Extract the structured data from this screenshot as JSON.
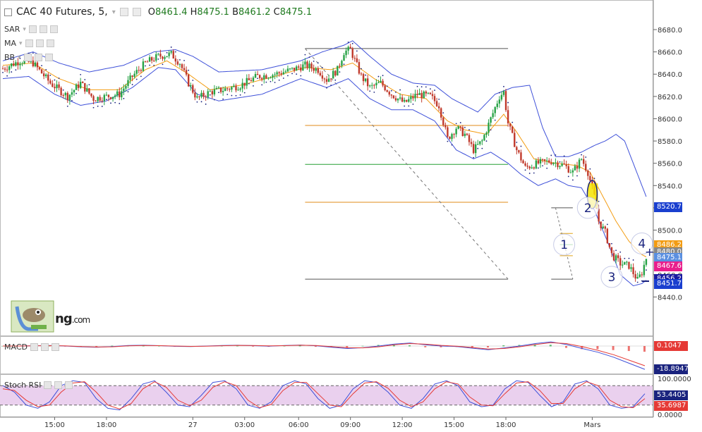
{
  "header": {
    "symbol": "CAC 40 Futures, 5,",
    "open_label": "O",
    "open": "8461.4",
    "high_label": "H",
    "high": "8475.1",
    "low_label": "B",
    "low": "8461.2",
    "close_label": "C",
    "close": "8475.1"
  },
  "indicators": {
    "sar": "SAR",
    "ma": "MA",
    "bb": "BB",
    "macd": "MACD",
    "stoch": "Stoch RSI"
  },
  "logo_text": "ng",
  "logo_suffix": ".com",
  "colors": {
    "up": "#26a245",
    "down": "#c0392b",
    "bb": "#3f51d9",
    "ma": "#f39c12",
    "sar": "#1a237e",
    "macd_line": "#3f51d9",
    "signal_line": "#e53935",
    "stoch_fill": "#ead0ee"
  },
  "chart_data": [
    {
      "type": "candlestick",
      "title": "CAC 40 Futures, 5",
      "ylim": [
        8436,
        8690
      ],
      "y_ticks": [
        "8680.0",
        "8660.0",
        "8640.0",
        "8620.0",
        "8600.0",
        "8580.0",
        "8560.0",
        "8540.0",
        "8520.7",
        "8500.0",
        "8480.0",
        "8460.0",
        "8440.0"
      ],
      "y_tick_values": [
        8680,
        8660,
        8640,
        8620,
        8600,
        8580,
        8560,
        8540,
        8520,
        8500,
        8480,
        8460,
        8440
      ],
      "x_ticks": [
        "15:00",
        "18:00",
        "27",
        "03:00",
        "06:00",
        "09:00",
        "12:00",
        "15:00",
        "18:00",
        "Mars"
      ],
      "x_tick_index": [
        24,
        48,
        88,
        112,
        137,
        161,
        185,
        209,
        233,
        273
      ],
      "close_path": [
        [
          0,
          8645
        ],
        [
          8,
          8652
        ],
        [
          14,
          8650
        ],
        [
          22,
          8632
        ],
        [
          30,
          8620
        ],
        [
          36,
          8632
        ],
        [
          42,
          8618
        ],
        [
          48,
          8620
        ],
        [
          54,
          8622
        ],
        [
          60,
          8638
        ],
        [
          66,
          8650
        ],
        [
          72,
          8656
        ],
        [
          78,
          8658
        ],
        [
          82,
          8650
        ],
        [
          86,
          8632
        ],
        [
          90,
          8618
        ],
        [
          96,
          8624
        ],
        [
          102,
          8626
        ],
        [
          110,
          8630
        ],
        [
          118,
          8638
        ],
        [
          126,
          8640
        ],
        [
          134,
          8644
        ],
        [
          140,
          8648
        ],
        [
          146,
          8644
        ],
        [
          150,
          8635
        ],
        [
          155,
          8644
        ],
        [
          158,
          8660
        ],
        [
          161,
          8662
        ],
        [
          166,
          8638
        ],
        [
          170,
          8628
        ],
        [
          175,
          8632
        ],
        [
          180,
          8622
        ],
        [
          186,
          8614
        ],
        [
          192,
          8622
        ],
        [
          198,
          8620
        ],
        [
          202,
          8612
        ],
        [
          206,
          8582
        ],
        [
          210,
          8592
        ],
        [
          214,
          8586
        ],
        [
          218,
          8572
        ],
        [
          222,
          8580
        ],
        [
          226,
          8600
        ],
        [
          230,
          8620
        ],
        [
          232,
          8624
        ],
        [
          234,
          8596
        ],
        [
          238,
          8572
        ],
        [
          242,
          8556
        ],
        [
          248,
          8560
        ],
        [
          254,
          8562
        ],
        [
          260,
          8558
        ],
        [
          264,
          8552
        ],
        [
          268,
          8564
        ],
        [
          271,
          8552
        ],
        [
          274,
          8530
        ],
        [
          276,
          8508
        ],
        [
          279,
          8498
        ],
        [
          282,
          8478
        ],
        [
          286,
          8470
        ],
        [
          290,
          8468
        ],
        [
          294,
          8455
        ],
        [
          296,
          8462
        ],
        [
          298,
          8475
        ]
      ],
      "bb_upper": [
        [
          0,
          8652
        ],
        [
          14,
          8660
        ],
        [
          26,
          8650
        ],
        [
          40,
          8642
        ],
        [
          56,
          8648
        ],
        [
          70,
          8660
        ],
        [
          80,
          8662
        ],
        [
          88,
          8656
        ],
        [
          100,
          8642
        ],
        [
          120,
          8644
        ],
        [
          138,
          8652
        ],
        [
          148,
          8660
        ],
        [
          158,
          8666
        ],
        [
          162,
          8670
        ],
        [
          170,
          8656
        ],
        [
          180,
          8640
        ],
        [
          190,
          8632
        ],
        [
          200,
          8630
        ],
        [
          208,
          8618
        ],
        [
          214,
          8612
        ],
        [
          220,
          8606
        ],
        [
          228,
          8622
        ],
        [
          236,
          8628
        ],
        [
          244,
          8630
        ],
        [
          250,
          8592
        ],
        [
          256,
          8566
        ],
        [
          262,
          8566
        ],
        [
          268,
          8570
        ],
        [
          274,
          8576
        ],
        [
          279,
          8580
        ],
        [
          284,
          8586
        ],
        [
          288,
          8580
        ],
        [
          292,
          8560
        ],
        [
          296,
          8540
        ],
        [
          298,
          8530
        ]
      ],
      "bb_lower": [
        [
          0,
          8636
        ],
        [
          12,
          8638
        ],
        [
          24,
          8622
        ],
        [
          36,
          8612
        ],
        [
          48,
          8616
        ],
        [
          60,
          8628
        ],
        [
          72,
          8646
        ],
        [
          80,
          8644
        ],
        [
          90,
          8622
        ],
        [
          100,
          8616
        ],
        [
          120,
          8622
        ],
        [
          138,
          8636
        ],
        [
          150,
          8628
        ],
        [
          160,
          8636
        ],
        [
          170,
          8618
        ],
        [
          180,
          8608
        ],
        [
          190,
          8608
        ],
        [
          200,
          8598
        ],
        [
          210,
          8572
        ],
        [
          218,
          8564
        ],
        [
          226,
          8570
        ],
        [
          234,
          8560
        ],
        [
          240,
          8550
        ],
        [
          248,
          8540
        ],
        [
          256,
          8546
        ],
        [
          262,
          8540
        ],
        [
          268,
          8538
        ],
        [
          274,
          8518
        ],
        [
          280,
          8490
        ],
        [
          286,
          8460
        ],
        [
          292,
          8450
        ],
        [
          296,
          8452
        ],
        [
          298,
          8455
        ]
      ],
      "ma": [
        [
          0,
          8648
        ],
        [
          14,
          8650
        ],
        [
          26,
          8636
        ],
        [
          40,
          8626
        ],
        [
          54,
          8626
        ],
        [
          66,
          8644
        ],
        [
          76,
          8652
        ],
        [
          86,
          8640
        ],
        [
          96,
          8626
        ],
        [
          110,
          8630
        ],
        [
          126,
          8638
        ],
        [
          140,
          8646
        ],
        [
          152,
          8644
        ],
        [
          162,
          8650
        ],
        [
          172,
          8636
        ],
        [
          184,
          8622
        ],
        [
          196,
          8618
        ],
        [
          206,
          8598
        ],
        [
          214,
          8590
        ],
        [
          224,
          8586
        ],
        [
          232,
          8604
        ],
        [
          238,
          8588
        ],
        [
          246,
          8564
        ],
        [
          256,
          8560
        ],
        [
          266,
          8558
        ],
        [
          272,
          8552
        ],
        [
          278,
          8530
        ],
        [
          284,
          8508
        ],
        [
          290,
          8490
        ],
        [
          296,
          8478
        ],
        [
          298,
          8476
        ]
      ],
      "horizontal_levels": [
        {
          "value": 8663,
          "color": "#555555",
          "from": 140,
          "to": 234
        },
        {
          "value": 8594,
          "color": "#e08b1a",
          "from": 140,
          "to": 234
        },
        {
          "value": 8559,
          "color": "#27a033",
          "from": 140,
          "to": 234
        },
        {
          "value": 8525,
          "color": "#e08b1a",
          "from": 140,
          "to": 234
        },
        {
          "value": 8456,
          "color": "#555555",
          "from": 140,
          "to": 234
        }
      ],
      "small_levels": [
        {
          "value": 8497,
          "color": "#e0a418"
        },
        {
          "value": 8487,
          "color": "#27a033"
        },
        {
          "value": 8477,
          "color": "#e0a418"
        }
      ],
      "annotations": [
        {
          "label": "1",
          "x": 260,
          "y": 8487
        },
        {
          "label": "2",
          "x": 271,
          "y": 8520
        },
        {
          "label": "3",
          "x": 282,
          "y": 8458
        },
        {
          "label": "4",
          "x": 296,
          "y": 8488
        }
      ],
      "price_labels": [
        {
          "text": "8520.7",
          "value": 8520.7,
          "color": "#1a3fcf"
        },
        {
          "text": "8486.2",
          "value": 8486.2,
          "color": "#f39c12"
        },
        {
          "text": "8480.0",
          "value": 8480.0,
          "color": "#888888"
        },
        {
          "text": "8475.1",
          "value": 8475.1,
          "color": "#5a8fe0"
        },
        {
          "text": "8467.6",
          "value": 8467.6,
          "color": "#e91e8c"
        },
        {
          "text": "8456.2",
          "value": 8456.2,
          "color": "#1a1aa0"
        },
        {
          "text": "8451.7",
          "value": 8451.7,
          "color": "#1a3fcf"
        }
      ]
    },
    {
      "type": "line",
      "title": "MACD",
      "series": [
        {
          "values": [
            0,
            0,
            0.2,
            0.4,
            0,
            -0.6,
            -1,
            -0.4,
            0.4,
            0.6,
            0.3,
            -0.2,
            -0.4,
            0,
            0.4,
            0.6,
            0.3,
            -0.1,
            0.4,
            0.8,
            0.2,
            -1,
            -2,
            -1.4,
            0,
            1.6,
            2.4,
            1,
            0,
            -0.4,
            -1.8,
            -3,
            -1.6,
            0,
            2,
            3.4,
            1.2,
            -2,
            -5,
            -9,
            -14,
            -18.9
          ]
        },
        {
          "values": [
            0,
            0,
            0.1,
            0.3,
            0.1,
            -0.4,
            -0.8,
            -0.6,
            0.1,
            0.4,
            0.3,
            0,
            -0.3,
            -0.1,
            0.2,
            0.5,
            0.4,
            0.1,
            0.3,
            0.6,
            0.4,
            -0.5,
            -1.4,
            -1.5,
            -0.6,
            1,
            2,
            1.5,
            0.5,
            -0.1,
            -1.2,
            -2.4,
            -2,
            -0.6,
            1.2,
            2.7,
            2,
            -0.5,
            -3.5,
            -7,
            -11.5,
            -16
          ]
        }
      ],
      "labels": [
        "0.1047",
        "-18.8947"
      ]
    },
    {
      "type": "line",
      "title": "Stoch RSI",
      "ylim": [
        0,
        100
      ],
      "bands": [
        20,
        80
      ],
      "series": [
        {
          "values": [
            80,
            60,
            20,
            10,
            30,
            80,
            95,
            90,
            40,
            10,
            5,
            40,
            85,
            95,
            60,
            20,
            15,
            50,
            90,
            95,
            70,
            20,
            10,
            30,
            80,
            95,
            85,
            40,
            10,
            20,
            70,
            95,
            90,
            60,
            20,
            10,
            40,
            85,
            95,
            80,
            30,
            15,
            20,
            70,
            95,
            90,
            50,
            15,
            30,
            85,
            95,
            70,
            20,
            10,
            15,
            55
          ]
        },
        {
          "values": [
            70,
            65,
            35,
            15,
            20,
            60,
            88,
            92,
            60,
            20,
            8,
            25,
            70,
            92,
            75,
            35,
            18,
            35,
            75,
            92,
            80,
            35,
            12,
            22,
            65,
            90,
            90,
            55,
            20,
            15,
            55,
            88,
            92,
            72,
            35,
            15,
            30,
            70,
            92,
            85,
            45,
            20,
            18,
            55,
            88,
            92,
            65,
            25,
            25,
            70,
            92,
            80,
            35,
            15,
            12,
            40
          ]
        }
      ],
      "labels": [
        "100.0000",
        "53.4405",
        "35.6987",
        "0.0000"
      ]
    }
  ]
}
